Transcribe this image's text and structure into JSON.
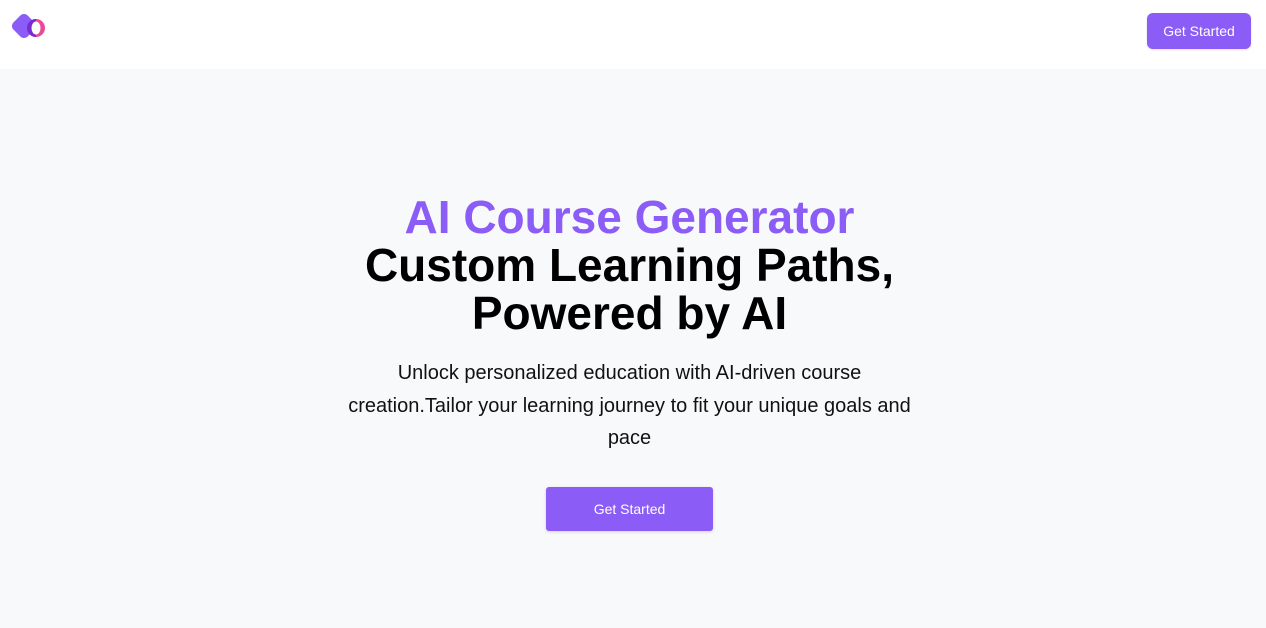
{
  "header": {
    "logo_icon": "brand-logo-icon",
    "cta_label": "Get Started"
  },
  "hero": {
    "title_accent": "AI Course Generator",
    "title_line1": "Custom Learning Paths,",
    "title_line2": "Powered by AI",
    "subtitle": "Unlock personalized education with AI-driven course creation.Tailor your learning journey to fit your unique goals and pace",
    "cta_label": "Get Started"
  },
  "colors": {
    "accent": "#8b5cf6",
    "logo_pink": "#ec4899",
    "background": "#f8f9fb",
    "header_bg": "#ffffff"
  }
}
